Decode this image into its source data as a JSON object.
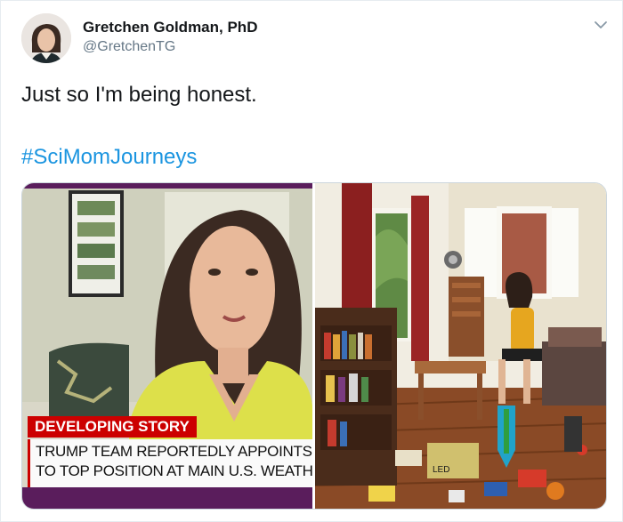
{
  "author": {
    "display_name": "Gretchen Goldman, PhD",
    "handle": "@GretchenTG"
  },
  "tweet": {
    "text": "Just so I'm being honest.",
    "hashtag": "#SciMomJourneys"
  },
  "media": {
    "left": {
      "banner_label": "DEVELOPING STORY",
      "headline_line1": "TRUMP TEAM REPORTEDLY APPOINTS C",
      "headline_line2": "TO TOP POSITION AT MAIN U.S. WEATHE"
    },
    "right": {
      "toy_label": "LED"
    }
  },
  "icons": {
    "menu": "chevron-down-icon"
  },
  "colors": {
    "hashtag": "#1b95e0",
    "breaking_red": "#cc0000",
    "cnn_bar_purple": "#5a1d5c"
  }
}
